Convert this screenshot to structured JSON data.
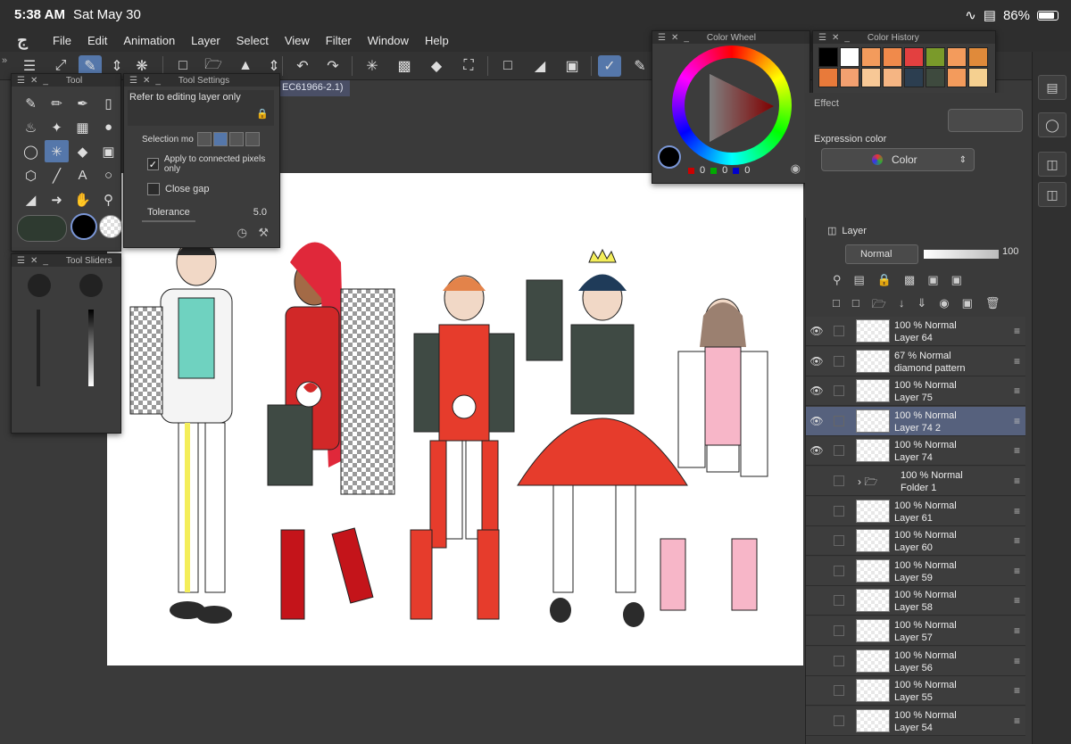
{
  "status": {
    "time": "5:38 AM",
    "date": "Sat May 30",
    "battery": "86%"
  },
  "menu": [
    "File",
    "Edit",
    "Animation",
    "Layer",
    "Select",
    "View",
    "Filter",
    "Window",
    "Help"
  ],
  "document_tab": "EC61966-2.1)",
  "tool_panel": {
    "title": "Tool"
  },
  "tool_settings": {
    "title": "Tool Settings",
    "refer": "Refer to editing layer only",
    "selection_mode": "Selection mo",
    "apply_connected": "Apply to connected pixels only",
    "close_gap": "Close gap",
    "tolerance_label": "Tolerance",
    "tolerance_value": "5.0"
  },
  "tool_sliders": {
    "title": "Tool Sliders"
  },
  "color_wheel": {
    "title": "Color Wheel",
    "r": "0",
    "g": "0",
    "b": "0"
  },
  "color_history": {
    "title": "Color History",
    "colors": [
      "#000000",
      "#ffffff",
      "#f39b5c",
      "#f08a4b",
      "#e34040",
      "#7a9a2a",
      "#f39b5c",
      "#e08a3a",
      "#e87a3a",
      "#f3a070",
      "#f7c896",
      "#f5b583",
      "#2c3e50",
      "#3e4a3e",
      "#f39b5c",
      "#f5d090"
    ]
  },
  "sub_tool_detail": {
    "effect": "Effect",
    "expression_label": "Expression color",
    "expression_value": "Color"
  },
  "layer_panel": {
    "title": "Layer",
    "blend_mode": "Normal",
    "opacity": "100",
    "layers": [
      {
        "pct": "100 %  Normal",
        "name": "Layer 64",
        "visible": true,
        "selected": false
      },
      {
        "pct": "67 %  Normal",
        "name": "diamond pattern",
        "visible": true,
        "selected": false
      },
      {
        "pct": "100 %  Normal",
        "name": "Layer 75",
        "visible": true,
        "selected": false
      },
      {
        "pct": "100 %  Normal",
        "name": "Layer 74 2",
        "visible": true,
        "selected": true
      },
      {
        "pct": "100 %  Normal",
        "name": "Layer 74",
        "visible": true,
        "selected": false
      },
      {
        "pct": "100 %  Normal",
        "name": "Folder 1",
        "visible": false,
        "selected": false
      },
      {
        "pct": "100 %  Normal",
        "name": "Layer 61",
        "visible": false,
        "selected": false
      },
      {
        "pct": "100 %  Normal",
        "name": "Layer 60",
        "visible": false,
        "selected": false
      },
      {
        "pct": "100 %  Normal",
        "name": "Layer 59",
        "visible": false,
        "selected": false
      },
      {
        "pct": "100 %  Normal",
        "name": "Layer 58",
        "visible": false,
        "selected": false
      },
      {
        "pct": "100 %  Normal",
        "name": "Layer 57",
        "visible": false,
        "selected": false
      },
      {
        "pct": "100 %  Normal",
        "name": "Layer 56",
        "visible": false,
        "selected": false
      },
      {
        "pct": "100 %  Normal",
        "name": "Layer 55",
        "visible": false,
        "selected": false
      },
      {
        "pct": "100 %  Normal",
        "name": "Layer 54",
        "visible": false,
        "selected": false
      }
    ]
  }
}
